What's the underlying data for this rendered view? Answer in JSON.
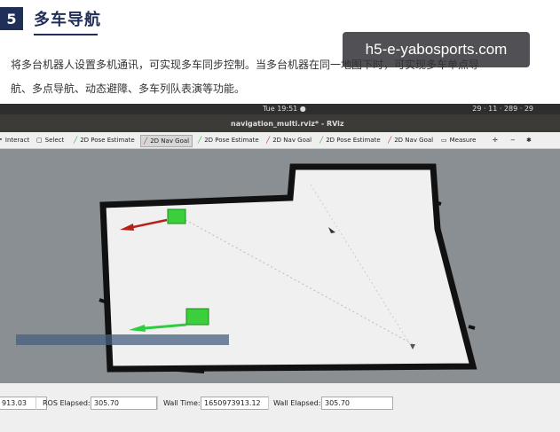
{
  "section": {
    "number": "5",
    "title": "多车导航"
  },
  "watermark": "h5-e-yabosports.com",
  "description": {
    "line1": "将多台机器人设置多机通讯，可实现多车同步控制。当多台机器在同一地图下时，可实现多车单点导",
    "line2": "航、多点导航、动态避障、多车列队表演等功能。"
  },
  "rviz": {
    "clock": "Tue 19:51 ●",
    "tray": "29 · 11 · 289 · 29",
    "window_title": "navigation_multi.rviz* - RViz",
    "toolbar": [
      {
        "label": "Interact",
        "icon": "cursor-icon"
      },
      {
        "label": "Select",
        "icon": "select-icon"
      },
      {
        "label": "2D Pose Estimate",
        "icon": "pose-arrow-icon"
      },
      {
        "label": "2D Nav Goal",
        "icon": "nav-goal-icon"
      },
      {
        "label": "2D Pose Estimate",
        "icon": "pose-arrow-icon"
      },
      {
        "label": "2D Nav Goal",
        "icon": "nav-goal-icon"
      },
      {
        "label": "2D Pose Estimate",
        "icon": "pose-arrow-icon"
      },
      {
        "label": "2D Nav Goal",
        "icon": "nav-goal-icon"
      },
      {
        "label": "Measure",
        "icon": "ruler-icon"
      }
    ],
    "status": {
      "ros_time_value": "913.03",
      "ros_elapsed_label": "ROS Elapsed:",
      "ros_elapsed_value": "305.70",
      "wall_time_label": "Wall Time:",
      "wall_time_value": "1650973913.12",
      "wall_elapsed_label": "Wall Elapsed:",
      "wall_elapsed_value": "305.70"
    },
    "colors": {
      "map_free": "#f0f0f0",
      "map_wall": "#111111",
      "background": "#8a8f94",
      "robot": "#3ccf3c",
      "arrow_red": "#b4221a",
      "arrow_green": "#2ecc40"
    }
  }
}
